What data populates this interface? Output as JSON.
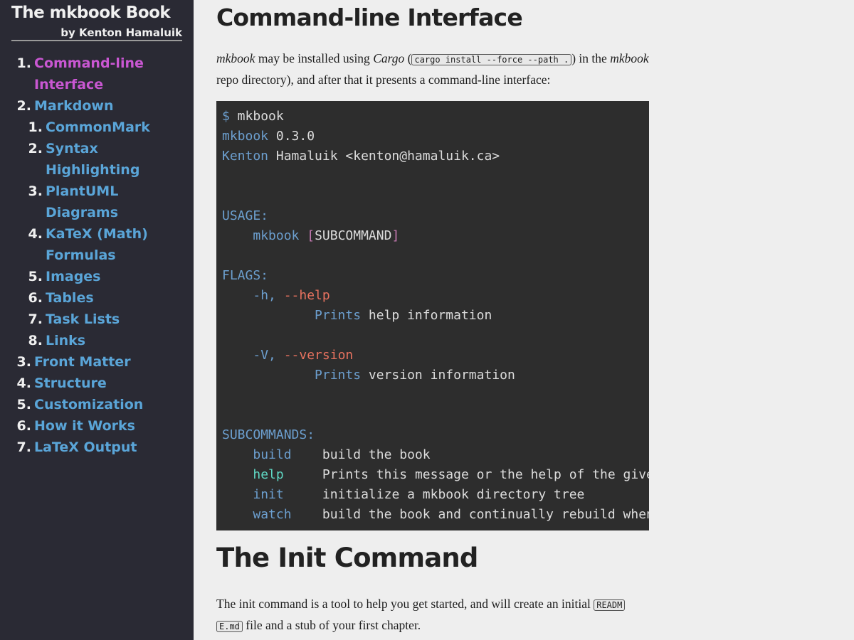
{
  "sidebar": {
    "title": "The mkbook Book",
    "author": "by Kenton Hamaluik",
    "toc": [
      {
        "num": "1.",
        "label": "Command-line",
        "label2": "Interface",
        "active": true
      },
      {
        "num": "2.",
        "label": "Markdown"
      },
      {
        "num": "1.",
        "label": "CommonMark"
      },
      {
        "num": "2.",
        "label": "Syntax",
        "label2": "Highlighting"
      },
      {
        "num": "3.",
        "label": "PlantUML",
        "label2": "Diagrams"
      },
      {
        "num": "4.",
        "label": "KaTeX (Math)",
        "label2": "Formulas"
      },
      {
        "num": "5.",
        "label": "Images"
      },
      {
        "num": "6.",
        "label": "Tables"
      },
      {
        "num": "7.",
        "label": "Task Lists"
      },
      {
        "num": "8.",
        "label": "Links"
      },
      {
        "num": "3.",
        "label": "Front Matter"
      },
      {
        "num": "4.",
        "label": "Structure"
      },
      {
        "num": "5.",
        "label": "Customization"
      },
      {
        "num": "6.",
        "label": "How it Works"
      },
      {
        "num": "7.",
        "label": "LaTeX Output"
      }
    ]
  },
  "main": {
    "h1_cli": "Command-line Interface",
    "para1": {
      "em1": "mkbook",
      "t1": " may be installed using ",
      "em2": "Cargo",
      "t2": " (",
      "code": "cargo install --force --path .",
      "t3": ") in the ",
      "em3": "mkbook",
      "t4": " repo directory), and after that it presents a command-line interface:"
    },
    "code_block": {
      "l1_prompt": "$",
      "l1_cmd": " mkbook",
      "l2_a": "mkbook",
      "l2_b": " 0.3.0",
      "l3_a": "Kenton",
      "l3_b": " Hamaluik <kenton@hamaluik.ca>",
      "usage": "USAGE:",
      "usage_cmd": "mkbook",
      "usage_lb": "[",
      "usage_sub": "SUBCOMMAND",
      "usage_rb": "]",
      "flags": "FLAGS:",
      "h_short": "-h,",
      "h_long": " --help",
      "h_desc_a": "Prints",
      "h_desc_b": " help information",
      "v_short": "-V,",
      "v_long": " --version",
      "v_desc_a": "Prints",
      "v_desc_b": " version information",
      "subcommands": "SUBCOMMANDS:",
      "sub1_name": "build",
      "sub1_desc": "build the book",
      "sub2_name": "help",
      "sub2_desc": "Prints this message or the help of the given subcommand(s)",
      "sub3_name": "init",
      "sub3_desc": "initialize a mkbook directory tree",
      "sub4_name": "watch",
      "sub4_desc": "build the book and continually rebuild whenever the source changes"
    },
    "h1_init": "The Init Command",
    "para2": {
      "t1": "The init command is a tool to help you get started, and will create an initial ",
      "code1": "READM",
      "code2": "E.md",
      "t2": " file and a stub of your first chapter."
    }
  }
}
